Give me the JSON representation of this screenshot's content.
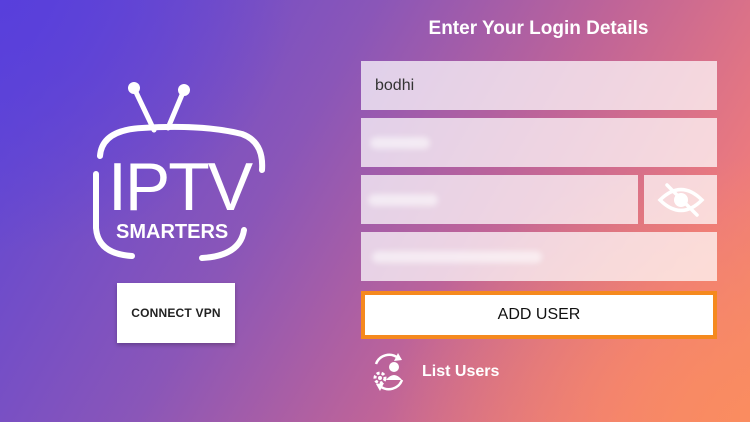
{
  "logo": {
    "line1": "IPTV",
    "line2": "SMARTERS"
  },
  "vpn": {
    "label": "CONNECT VPN"
  },
  "form": {
    "title": "Enter Your Login Details",
    "username_value": "bodhi",
    "add_user_label": "ADD USER",
    "list_users_label": "List Users"
  },
  "icons": {
    "password_toggle": "eye-slash-icon",
    "list_users": "users-settings-icon"
  },
  "colors": {
    "focus_border": "#f5891e",
    "field_bg": "#ffffffb8"
  }
}
